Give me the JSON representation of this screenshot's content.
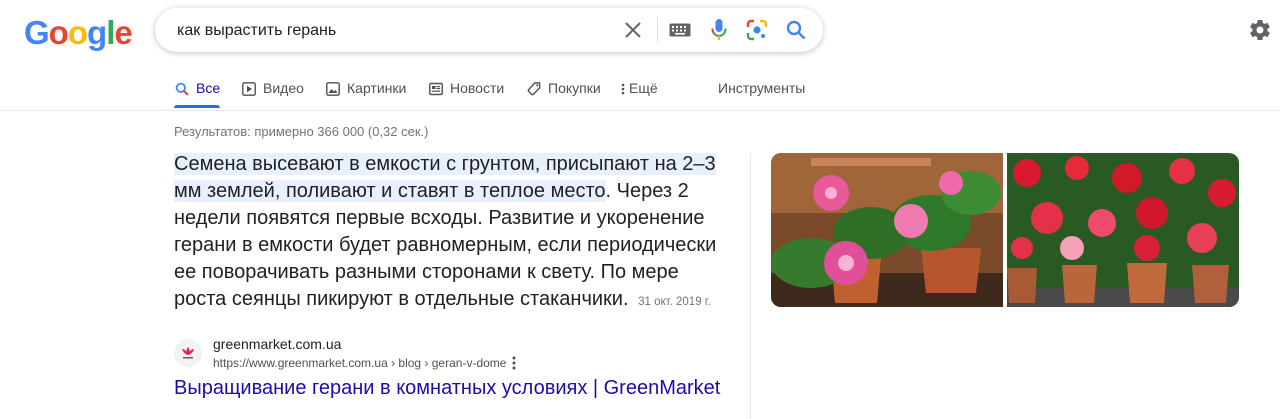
{
  "logo": {
    "letters": [
      "G",
      "o",
      "o",
      "g",
      "l",
      "e"
    ],
    "colors": [
      "#4285F4",
      "#EA4335",
      "#FBBC05",
      "#4285F4",
      "#34A853",
      "#EA4335"
    ]
  },
  "search": {
    "query": "как вырастить герань"
  },
  "icons": {
    "clear": "close-icon",
    "keyboard": "keyboard-icon",
    "voice": "microphone-icon",
    "lens": "google-lens-icon",
    "search": "search-icon",
    "settings": "gear-icon"
  },
  "tabs": [
    {
      "label": "Все",
      "icon": "search-icon",
      "active": true
    },
    {
      "label": "Видео",
      "icon": "play-icon"
    },
    {
      "label": "Картинки",
      "icon": "image-icon"
    },
    {
      "label": "Новости",
      "icon": "news-icon"
    },
    {
      "label": "Покупки",
      "icon": "tag-icon"
    },
    {
      "label": "Ещё",
      "icon": "more-vert-icon"
    }
  ],
  "tools_label": "Инструменты",
  "results_stats": "Результатов: примерно 366 000 (0,32 сек.)",
  "featured_snippet": {
    "highlighted": "Семена высевают в емкости с грунтом, присыпают на 2–3 мм землей, поливают и ставят в теплое место",
    "rest": ". Через 2 недели появятся первые всходы. Развитие и укоренение герани в емкости будет равномерным, если периодически ее поворачивать разными сторонами к свету. По мере роста сеянцы пикируют в отдельные стаканчики.",
    "date": "31 окт. 2019 г."
  },
  "result": {
    "site_name": "greenmarket.com.ua",
    "url": "https://www.greenmarket.com.ua › blog › geran-v-dome",
    "title": "Выращивание герани в комнатных условиях | GreenMarket"
  },
  "colors": {
    "link": "#1a0dab",
    "accent": "#1a73e8",
    "highlight": "#e8f0fe"
  }
}
